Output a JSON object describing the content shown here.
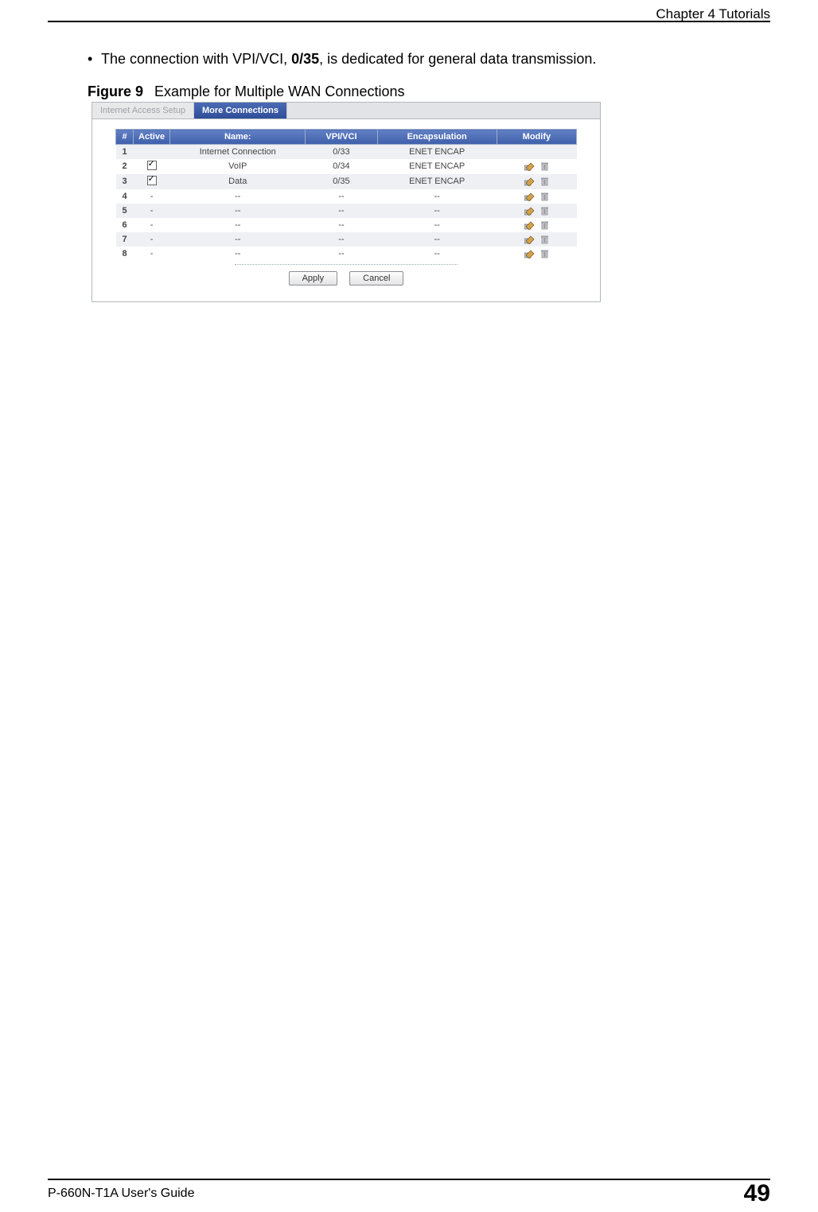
{
  "meta": {
    "chapter_header": "Chapter 4 Tutorials",
    "footer_guide": "P-660N-T1A User's Guide",
    "page_number": "49"
  },
  "bullet": {
    "pre": "The connection with VPI/VCI, ",
    "vpivci": "0/35",
    "post": ", is dedicated for general data transmission."
  },
  "figure": {
    "label": "Figure 9",
    "caption": "Example for Multiple WAN Connections"
  },
  "screenshot": {
    "tabs": {
      "inactive": "Internet Access Setup",
      "active": "More Connections"
    },
    "headers": {
      "num": "#",
      "active": "Active",
      "name": "Name:",
      "vpivci": "VPI/VCI",
      "encap": "Encapsulation",
      "modify": "Modify"
    },
    "rows": [
      {
        "num": "1",
        "active_box": "none",
        "name": "Internet Connection",
        "vpivci": "0/33",
        "encap": "ENET ENCAP",
        "modify": false
      },
      {
        "num": "2",
        "active_box": "checked",
        "name": "VoIP",
        "vpivci": "0/34",
        "encap": "ENET ENCAP",
        "modify": true
      },
      {
        "num": "3",
        "active_box": "checked",
        "name": "Data",
        "vpivci": "0/35",
        "encap": "ENET ENCAP",
        "modify": true
      },
      {
        "num": "4",
        "active_box": "dash",
        "name": "--",
        "vpivci": "--",
        "encap": "--",
        "modify": true
      },
      {
        "num": "5",
        "active_box": "dash",
        "name": "--",
        "vpivci": "--",
        "encap": "--",
        "modify": true
      },
      {
        "num": "6",
        "active_box": "dash",
        "name": "--",
        "vpivci": "--",
        "encap": "--",
        "modify": true
      },
      {
        "num": "7",
        "active_box": "dash",
        "name": "--",
        "vpivci": "--",
        "encap": "--",
        "modify": true
      },
      {
        "num": "8",
        "active_box": "dash",
        "name": "--",
        "vpivci": "--",
        "encap": "--",
        "modify": true
      }
    ],
    "buttons": {
      "apply": "Apply",
      "cancel": "Cancel"
    }
  }
}
